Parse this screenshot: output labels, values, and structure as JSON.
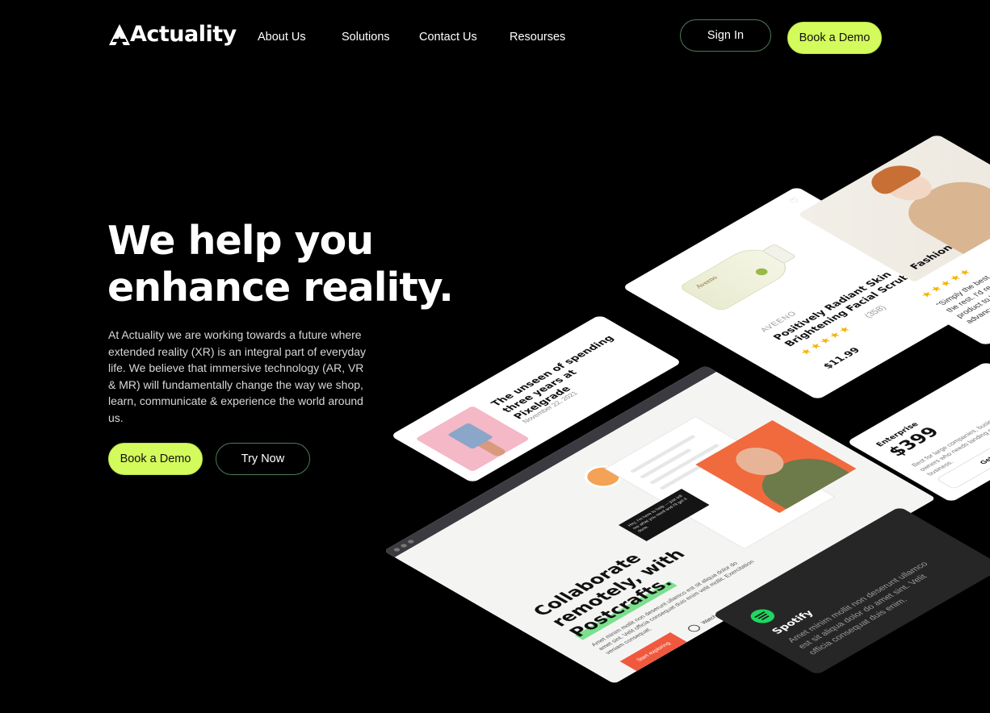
{
  "nav": {
    "logo": "Actuality",
    "links": [
      "About Us",
      "Solutions",
      "Contact Us",
      "Resourses"
    ],
    "sign_in": "Sign In",
    "book_demo": "Book a Demo"
  },
  "hero": {
    "title": "We help you enhance reality.",
    "body": "At Actuality we are working towards a future where extended reality (XR) is an integral part of everyday life. We believe that immersive technology (AR, VR & MR) will fundamentally change the way we shop, learn, communicate & experience the world around us.",
    "cta_primary": "Book a Demo",
    "cta_secondary": "Try Now"
  },
  "cards": {
    "blog": {
      "title": "The unseen of spending three years at Pixelgrade",
      "date": "November 22, 2021"
    },
    "product": {
      "brand_label": "Aveeno",
      "brand": "AVEENO",
      "name": "Positively Radiant Skin Brightening Facial Scrub",
      "stars": "★★★★★",
      "reviews": "(358)",
      "price": "$11.99"
    },
    "fashion": {
      "label": "Fashion"
    },
    "review": {
      "stars": "★★★★★",
      "text": "“Simply the best. Better than all the rest. I'd recommend this product to beginners and advanced users.”"
    },
    "pricing": {
      "tier": "Enterprise",
      "price": "$399",
      "description": "Best for large companies, business owners who needs landing page for their business.",
      "button": "Get Started"
    },
    "spotify": {
      "title": "Spotify",
      "body": "Amet minim mollit non deserunt ullamco est sit aliqua dolor do amet sint. Velit officia consequat duis enim."
    },
    "postcrafts": {
      "title_line1": "Collaborate",
      "title_line2": "remotely, with",
      "title_hl": "Postcrafts.",
      "body": "Amet minim mollit non deserunt ullamco est sit aliqua dolor do amet sint. Velit officia consequat duis enim velit mollit. Exercitation veniam consequat.",
      "cta": "Start exploring",
      "watch": "Watch video",
      "chat": "Hey, I'm here to help — just tell me what you need and I'll get it done."
    }
  },
  "colors": {
    "accent": "#d4fb5c",
    "background": "#000000",
    "spotify_green": "#1ed760",
    "postcrafts_orange": "#f0593e"
  }
}
